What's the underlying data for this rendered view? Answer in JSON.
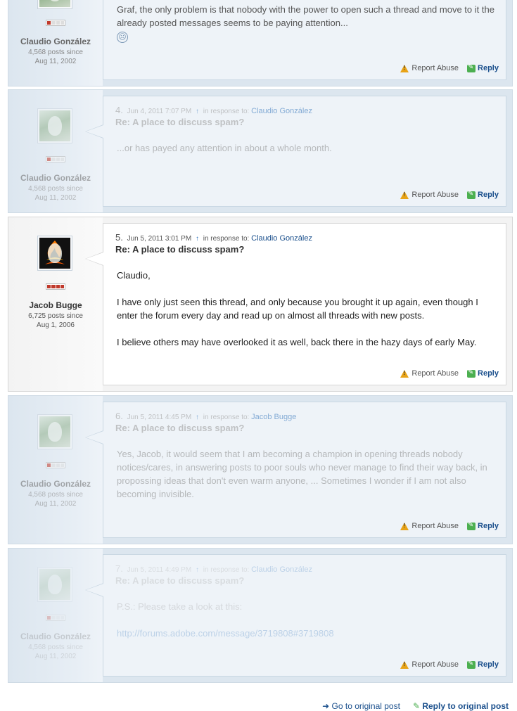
{
  "post3": {
    "author": "Claudio González",
    "stats": "4,568 posts since",
    "since": "Aug 11, 2002",
    "body_line1": "Graf, the only problem is that nobody with the power to open such a thread and move to it the",
    "body_line2": "already posted messages seems to be paying attention...",
    "emoticon": "☹"
  },
  "post4": {
    "number": "4.",
    "date": "Jun 4, 2011 7:07 PM",
    "in_response": "in response to:",
    "response_to": "Claudio González",
    "subject": "Re: A place to discuss spam?",
    "body": "...or has payed any attention in about a whole month.",
    "author": "Claudio González",
    "stats": "4,568 posts since",
    "since": "Aug 11, 2002"
  },
  "post5": {
    "number": "5.",
    "date": "Jun 5, 2011 3:01 PM",
    "in_response": "in response to:",
    "response_to": "Claudio González",
    "subject": "Re: A place to discuss spam?",
    "p1": "Claudio,",
    "p2_line1": "I have only just seen this thread, and only because you brought it up again, even though I",
    "p2_line2": "enter the forum every day and read up on almost all threads with new posts.",
    "p3": "I believe others may have overlooked it as well, back there in the hazy days of early May.",
    "author": "Jacob Bugge",
    "stats": "6,725 posts since",
    "since": "Aug 1, 2006"
  },
  "post6": {
    "number": "6.",
    "date": "Jun 5, 2011 4:45 PM",
    "in_response": "in response to:",
    "response_to": "Jacob Bugge",
    "subject": "Re: A place to discuss spam?",
    "line1": "Yes, Jacob, it would seem that I am becoming a champion in opening threads nobody",
    "line2": "notices/cares, in answering posts to poor souls who never manage to find their way back, in",
    "line3": "propossing ideas that don't even warm anyone, ... Sometimes I wonder if I am not also",
    "line4": "becoming invisible.",
    "author": "Claudio González",
    "stats": "4,568 posts since",
    "since": "Aug 11, 2002"
  },
  "post7": {
    "number": "7.",
    "date": "Jun 5, 2011 4:49 PM",
    "in_response": "in response to:",
    "response_to": "Claudio González",
    "subject": "Re: A place to discuss spam?",
    "p1": "P.S.: Please take a look at this:",
    "link": "http://forums.adobe.com/message/3719808#3719808",
    "author": "Claudio González",
    "stats": "4,568 posts since",
    "since": "Aug 11, 2002"
  },
  "actions": {
    "report": "Report Abuse",
    "reply": "Reply"
  },
  "nav": {
    "original": "Go to original post",
    "reply_original": "Reply to original post"
  }
}
